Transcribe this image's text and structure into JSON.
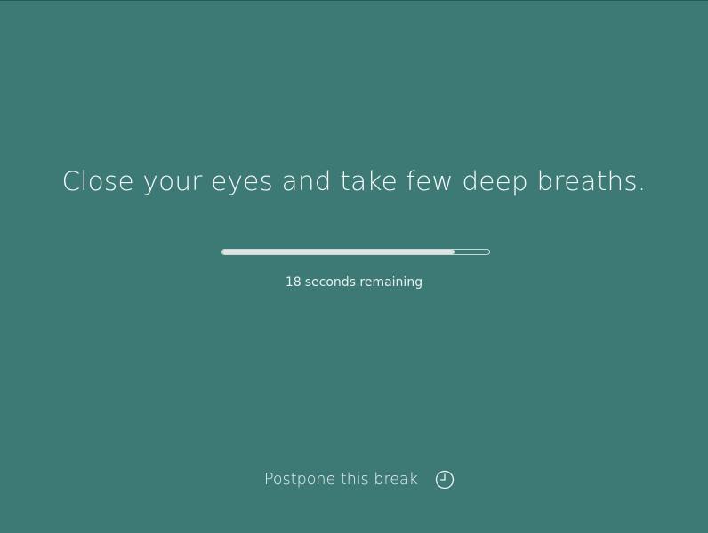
{
  "break_screen": {
    "message": "Close your eyes and take few deep breaths.",
    "progress_fraction": 0.87,
    "remaining_seconds": "18",
    "remaining_suffix": "seconds remaining",
    "postpone_label": "Postpone this break",
    "postpone_icon": "clock-icon"
  },
  "colors": {
    "background": "#3e7a75",
    "text": "#f4f8f7",
    "progress_fill": "#dce3e2"
  }
}
